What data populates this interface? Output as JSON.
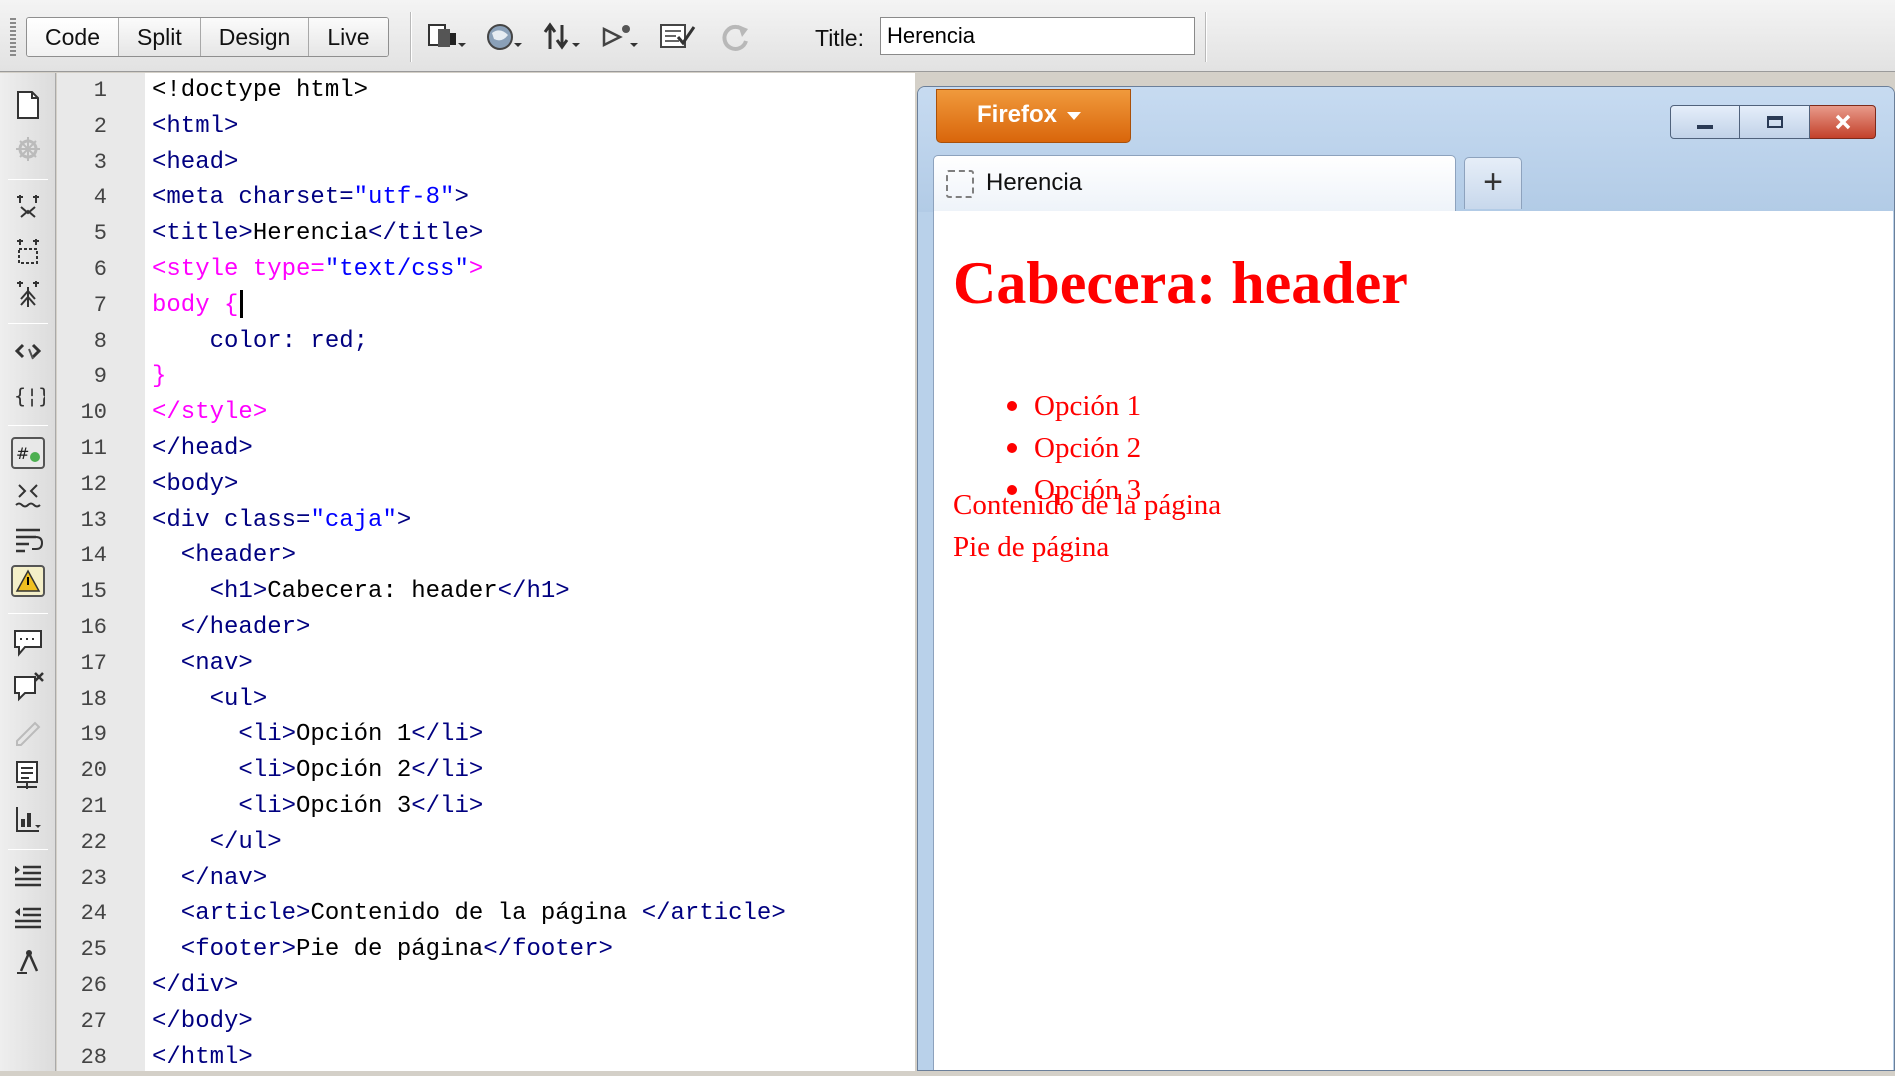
{
  "toolbar": {
    "view_buttons": [
      "Code",
      "Split",
      "Design",
      "Live"
    ],
    "title_label": "Title:",
    "title_value": "Herencia",
    "icons": [
      "multiscreen-icon",
      "preview-browser-icon",
      "file-management-icon",
      "visual-aids-icon",
      "check-page-icon",
      "refresh-icon"
    ]
  },
  "left_toolbar": {
    "icons": [
      "open-documents-icon",
      "show-code-navigator-icon",
      "collapse-full-tag-icon",
      "collapse-selection-icon",
      "expand-all-icon",
      "select-parent-tag-icon",
      "balance-braces-icon",
      "line-numbers-icon",
      "highlight-invalid-code-icon",
      "word-wrap-icon",
      "syntax-error-alerts-icon",
      "apply-comment-icon",
      "remove-comment-icon",
      "wrap-tag-icon",
      "recent-snippets-icon",
      "move-css-icon",
      "indent-code-icon",
      "outdent-code-icon",
      "format-source-code-icon"
    ]
  },
  "editor": {
    "lines": [
      {
        "n": "1",
        "parts": [
          [
            "t",
            "<!doctype html>"
          ]
        ]
      },
      {
        "n": "2",
        "parts": [
          [
            "k",
            "<html>"
          ]
        ]
      },
      {
        "n": "3",
        "parts": [
          [
            "k",
            "<head>"
          ]
        ]
      },
      {
        "n": "4",
        "parts": [
          [
            "k",
            "<meta charset="
          ],
          [
            "s",
            "\"utf-8\""
          ],
          [
            "k",
            ">"
          ]
        ]
      },
      {
        "n": "5",
        "parts": [
          [
            "k",
            "<title>"
          ],
          [
            "t",
            "Herencia"
          ],
          [
            "k",
            "</title>"
          ]
        ]
      },
      {
        "n": "6",
        "parts": [
          [
            "css-sel",
            "<style type="
          ],
          [
            "s",
            "\"text/css\""
          ],
          [
            "css-sel",
            ">"
          ]
        ]
      },
      {
        "n": "7",
        "parts": [
          [
            "css-sel",
            "body {"
          ]
        ]
      },
      {
        "n": "8",
        "parts": [
          [
            "css-prop",
            "    color: red;"
          ]
        ]
      },
      {
        "n": "9",
        "parts": [
          [
            "css-sel",
            "}"
          ]
        ]
      },
      {
        "n": "10",
        "parts": [
          [
            "css-sel",
            "</style>"
          ]
        ]
      },
      {
        "n": "11",
        "parts": [
          [
            "k",
            "</head>"
          ]
        ]
      },
      {
        "n": "12",
        "parts": [
          [
            "k",
            "<body>"
          ]
        ]
      },
      {
        "n": "13",
        "parts": [
          [
            "k",
            "<div class="
          ],
          [
            "s",
            "\"caja\""
          ],
          [
            "k",
            ">"
          ]
        ]
      },
      {
        "n": "14",
        "parts": [
          [
            "k",
            "  <header>"
          ]
        ]
      },
      {
        "n": "15",
        "parts": [
          [
            "k",
            "    <h1>"
          ],
          [
            "t",
            "Cabecera: header"
          ],
          [
            "k",
            "</h1>"
          ]
        ]
      },
      {
        "n": "16",
        "parts": [
          [
            "k",
            "  </header>"
          ]
        ]
      },
      {
        "n": "17",
        "parts": [
          [
            "k",
            "  <nav>"
          ]
        ]
      },
      {
        "n": "18",
        "parts": [
          [
            "k",
            "    <ul>"
          ]
        ]
      },
      {
        "n": "19",
        "parts": [
          [
            "k",
            "      <li>"
          ],
          [
            "t",
            "Opción 1"
          ],
          [
            "k",
            "</li>"
          ]
        ]
      },
      {
        "n": "20",
        "parts": [
          [
            "k",
            "      <li>"
          ],
          [
            "t",
            "Opción 2"
          ],
          [
            "k",
            "</li>"
          ]
        ]
      },
      {
        "n": "21",
        "parts": [
          [
            "k",
            "      <li>"
          ],
          [
            "t",
            "Opción 3"
          ],
          [
            "k",
            "</li>"
          ]
        ]
      },
      {
        "n": "22",
        "parts": [
          [
            "k",
            "    </ul>"
          ]
        ]
      },
      {
        "n": "23",
        "parts": [
          [
            "k",
            "  </nav>"
          ]
        ]
      },
      {
        "n": "24",
        "parts": [
          [
            "k",
            "  <article>"
          ],
          [
            "t",
            "Contenido de la página "
          ],
          [
            "k",
            "</article>"
          ]
        ]
      },
      {
        "n": "25",
        "parts": [
          [
            "k",
            "  <footer>"
          ],
          [
            "t",
            "Pie de página"
          ],
          [
            "k",
            "</footer>"
          ]
        ]
      },
      {
        "n": "26",
        "parts": [
          [
            "k",
            "</div>"
          ]
        ]
      },
      {
        "n": "27",
        "parts": [
          [
            "k",
            "</body>"
          ]
        ]
      },
      {
        "n": "28",
        "parts": [
          [
            "k",
            "</html>"
          ]
        ]
      }
    ]
  },
  "browser": {
    "menu_label": "Firefox",
    "tab_label": "Herencia",
    "new_tab_label": "+",
    "page": {
      "heading": "Cabecera: header",
      "options": [
        "Opción 1",
        "Opción 2",
        "Opción 3"
      ],
      "article": "Contenido de la página",
      "footer": "Pie de página"
    }
  },
  "colors": {
    "page_text": "#ff0000",
    "firefox_button": "#e07a1f",
    "frame": "#b9d1ea"
  }
}
